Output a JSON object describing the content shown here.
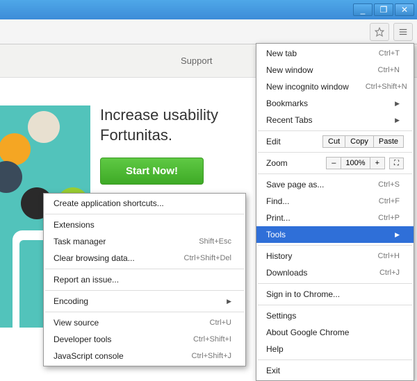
{
  "window": {
    "min": "_",
    "max": "❐",
    "close": "✕"
  },
  "nav": {
    "support": "Support"
  },
  "hero": {
    "line1": "Increase usability",
    "line2": "Fortunitas.",
    "cta": "Start Now!"
  },
  "mainMenu": {
    "newTab": "New tab",
    "newTabSc": "Ctrl+T",
    "newWindow": "New window",
    "newWindowSc": "Ctrl+N",
    "newIncognito": "New incognito window",
    "newIncognitoSc": "Ctrl+Shift+N",
    "bookmarks": "Bookmarks",
    "recentTabs": "Recent Tabs",
    "edit": "Edit",
    "cut": "Cut",
    "copy": "Copy",
    "paste": "Paste",
    "zoom": "Zoom",
    "zoomOut": "–",
    "zoomPct": "100%",
    "zoomIn": "+",
    "savePage": "Save page as...",
    "savePageSc": "Ctrl+S",
    "find": "Find...",
    "findSc": "Ctrl+F",
    "print": "Print...",
    "printSc": "Ctrl+P",
    "tools": "Tools",
    "history": "History",
    "historySc": "Ctrl+H",
    "downloads": "Downloads",
    "downloadsSc": "Ctrl+J",
    "signIn": "Sign in to Chrome...",
    "settings": "Settings",
    "about": "About Google Chrome",
    "help": "Help",
    "exit": "Exit"
  },
  "subMenu": {
    "createShortcuts": "Create application shortcuts...",
    "extensions": "Extensions",
    "taskManager": "Task manager",
    "taskManagerSc": "Shift+Esc",
    "clearData": "Clear browsing data...",
    "clearDataSc": "Ctrl+Shift+Del",
    "reportIssue": "Report an issue...",
    "encoding": "Encoding",
    "viewSource": "View source",
    "viewSourceSc": "Ctrl+U",
    "devTools": "Developer tools",
    "devToolsSc": "Ctrl+Shift+I",
    "jsConsole": "JavaScript console",
    "jsConsoleSc": "Ctrl+Shift+J"
  }
}
